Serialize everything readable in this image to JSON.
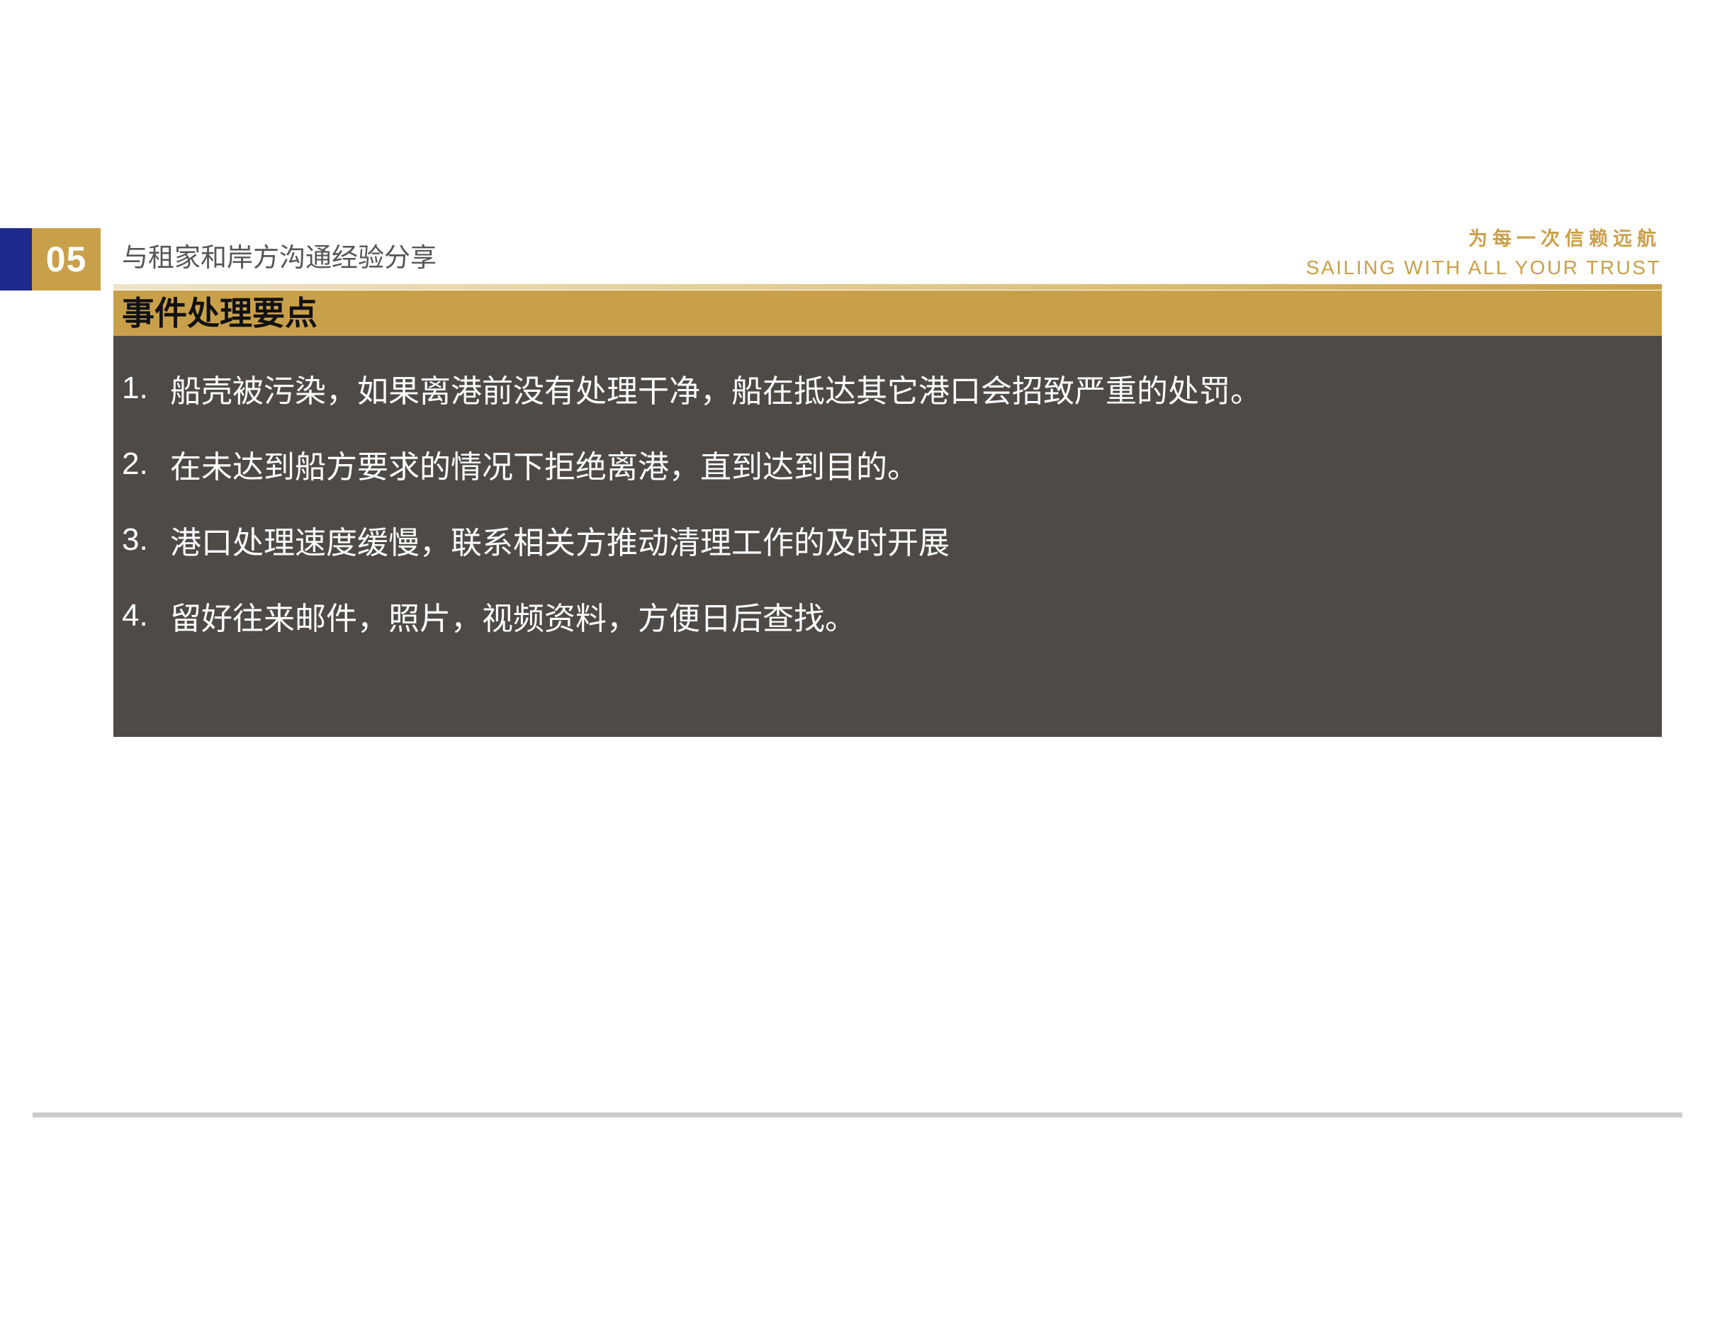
{
  "header": {
    "section_number": "05",
    "title": "与租家和岸方沟通经验分享",
    "slogan_cn": "为每一次信赖远航",
    "slogan_en": "SAILING WITH ALL YOUR TRUST"
  },
  "card": {
    "title": "事件处理要点",
    "items": [
      {
        "num": "1.",
        "text": "船壳被污染，如果离港前没有处理干净，船在抵达其它港口会招致严重的处罚。"
      },
      {
        "num": "2.",
        "text": "在未达到船方要求的情况下拒绝离港，直到达到目的。"
      },
      {
        "num": "3.",
        "text": "港口处理速度缓慢，联系相关方推动清理工作的及时开展"
      },
      {
        "num": "4.",
        "text": "留好往来邮件，照片，视频资料，方便日后查找。"
      }
    ]
  },
  "colors": {
    "navy": "#1e2a8c",
    "gold": "#c9a04a",
    "card_bg": "#4e4a47",
    "footer_rule": "#cccccc"
  }
}
